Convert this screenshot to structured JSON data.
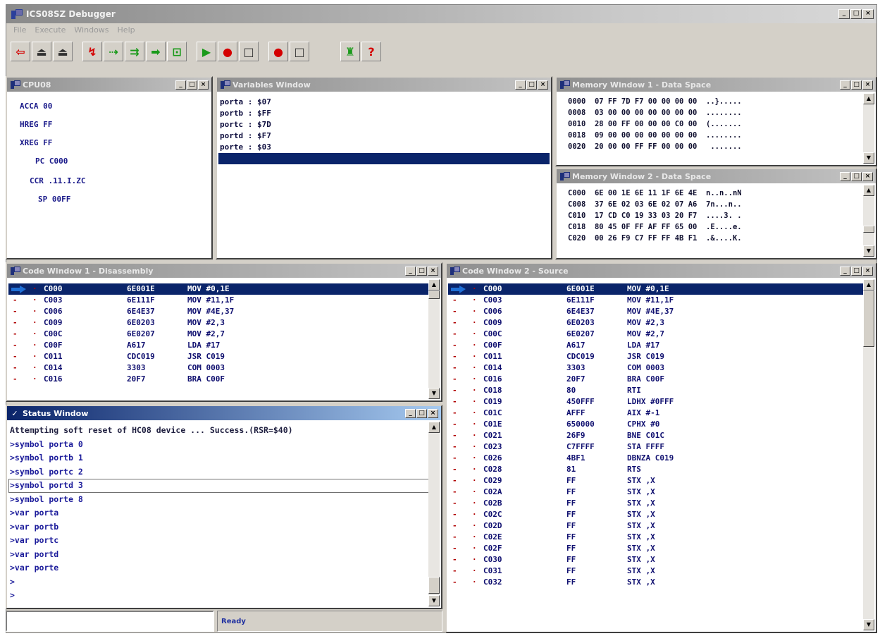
{
  "app": {
    "title": "ICS08SZ Debugger",
    "menu": [
      "File",
      "Execute",
      "Windows",
      "Help"
    ]
  },
  "cpu": {
    "title": "CPU08",
    "registers": [
      {
        "name": "ACCA",
        "value": "00"
      },
      {
        "name": "HREG",
        "value": "FF"
      },
      {
        "name": "XREG",
        "value": "FF"
      },
      {
        "name": "PC",
        "value": "C000"
      },
      {
        "name": "CCR",
        "value": ".11.I.ZC"
      },
      {
        "name": "SP",
        "value": "00FF"
      }
    ]
  },
  "variables": {
    "title": "Variables Window",
    "rows": [
      "porta : $07",
      "portb : $FF",
      "portc : $7D",
      "portd : $F7",
      "porte : $03"
    ]
  },
  "memory1": {
    "title": "Memory Window 1 - Data Space",
    "rows": [
      {
        "addr": "0000",
        "bytes": "07 FF 7D F7 00 00 00 00",
        "ascii": "..}....."
      },
      {
        "addr": "0008",
        "bytes": "03 00 00 00 00 00 00 00",
        "ascii": "........"
      },
      {
        "addr": "0010",
        "bytes": "28 00 FF 00 00 00 C0 00",
        "ascii": "(......."
      },
      {
        "addr": "0018",
        "bytes": "09 00 00 00 00 00 00 00",
        "ascii": "........"
      },
      {
        "addr": "0020",
        "bytes": "20 00 00 FF FF 00 00 00",
        "ascii": " ......."
      }
    ]
  },
  "memory2": {
    "title": "Memory Window 2 - Data Space",
    "rows": [
      {
        "addr": "C000",
        "bytes": "6E 00 1E 6E 11 1F 6E 4E",
        "ascii": "n..n..nN"
      },
      {
        "addr": "C008",
        "bytes": "37 6E 02 03 6E 02 07 A6",
        "ascii": "7n...n.."
      },
      {
        "addr": "C010",
        "bytes": "17 CD C0 19 33 03 20 F7",
        "ascii": "....3. ."
      },
      {
        "addr": "C018",
        "bytes": "80 45 0F FF AF FF 65 00",
        "ascii": ".E....e."
      },
      {
        "addr": "C020",
        "bytes": "00 26 F9 C7 FF FF 4B F1",
        "ascii": ".&....K."
      }
    ]
  },
  "code1": {
    "title": "Code Window 1 - Disassembly",
    "rows": [
      {
        "addr": "C000",
        "hex": "6E001E",
        "asm": "MOV #0,1E"
      },
      {
        "addr": "C003",
        "hex": "6E111F",
        "asm": "MOV #11,1F"
      },
      {
        "addr": "C006",
        "hex": "6E4E37",
        "asm": "MOV #4E,37"
      },
      {
        "addr": "C009",
        "hex": "6E0203",
        "asm": "MOV #2,3"
      },
      {
        "addr": "C00C",
        "hex": "6E0207",
        "asm": "MOV #2,7"
      },
      {
        "addr": "C00F",
        "hex": "A617",
        "asm": "LDA #17"
      },
      {
        "addr": "C011",
        "hex": "CDC019",
        "asm": "JSR C019"
      },
      {
        "addr": "C014",
        "hex": "3303",
        "asm": "COM 0003"
      },
      {
        "addr": "C016",
        "hex": "20F7",
        "asm": "BRA C00F"
      }
    ]
  },
  "code2": {
    "title": "Code Window 2 - Source",
    "rows": [
      {
        "addr": "C000",
        "hex": "6E001E",
        "asm": "MOV #0,1E"
      },
      {
        "addr": "C003",
        "hex": "6E111F",
        "asm": "MOV #11,1F"
      },
      {
        "addr": "C006",
        "hex": "6E4E37",
        "asm": "MOV #4E,37"
      },
      {
        "addr": "C009",
        "hex": "6E0203",
        "asm": "MOV #2,3"
      },
      {
        "addr": "C00C",
        "hex": "6E0207",
        "asm": "MOV #2,7"
      },
      {
        "addr": "C00F",
        "hex": "A617",
        "asm": "LDA #17"
      },
      {
        "addr": "C011",
        "hex": "CDC019",
        "asm": "JSR C019"
      },
      {
        "addr": "C014",
        "hex": "3303",
        "asm": "COM 0003"
      },
      {
        "addr": "C016",
        "hex": "20F7",
        "asm": "BRA C00F"
      },
      {
        "addr": "C018",
        "hex": "80",
        "asm": "RTI"
      },
      {
        "addr": "C019",
        "hex": "450FFF",
        "asm": "LDHX #0FFF"
      },
      {
        "addr": "C01C",
        "hex": "AFFF",
        "asm": "AIX #-1"
      },
      {
        "addr": "C01E",
        "hex": "650000",
        "asm": "CPHX #0"
      },
      {
        "addr": "C021",
        "hex": "26F9",
        "asm": "BNE C01C"
      },
      {
        "addr": "C023",
        "hex": "C7FFFF",
        "asm": "STA FFFF"
      },
      {
        "addr": "C026",
        "hex": "4BF1",
        "asm": "DBNZA C019"
      },
      {
        "addr": "C028",
        "hex": "81",
        "asm": "RTS"
      },
      {
        "addr": "C029",
        "hex": "FF",
        "asm": "STX ,X"
      },
      {
        "addr": "C02A",
        "hex": "FF",
        "asm": "STX ,X"
      },
      {
        "addr": "C02B",
        "hex": "FF",
        "asm": "STX ,X"
      },
      {
        "addr": "C02C",
        "hex": "FF",
        "asm": "STX ,X"
      },
      {
        "addr": "C02D",
        "hex": "FF",
        "asm": "STX ,X"
      },
      {
        "addr": "C02E",
        "hex": "FF",
        "asm": "STX ,X"
      },
      {
        "addr": "C02F",
        "hex": "FF",
        "asm": "STX ,X"
      },
      {
        "addr": "C030",
        "hex": "FF",
        "asm": "STX ,X"
      },
      {
        "addr": "C031",
        "hex": "FF",
        "asm": "STX ,X"
      },
      {
        "addr": "C032",
        "hex": "FF",
        "asm": "STX ,X"
      }
    ]
  },
  "status": {
    "title": "Status Window",
    "lines": [
      "Attempting soft reset of HC08 device ... Success.(RSR=$40)",
      ">symbol porta 0",
      ">symbol portb 1",
      ">symbol portc 2",
      ">symbol portd 3",
      ">symbol porte 8",
      ">var porta",
      ">var portb",
      ">var portc",
      ">var portd",
      ">var porte",
      ">",
      ">"
    ],
    "ready": "Ready"
  },
  "colors": {
    "selection": "#0a246a",
    "active_title": "#0a246a",
    "register_text": "#1a1a8a",
    "marker_red": "#b00000",
    "pc_arrow": "#1f6fd6"
  }
}
